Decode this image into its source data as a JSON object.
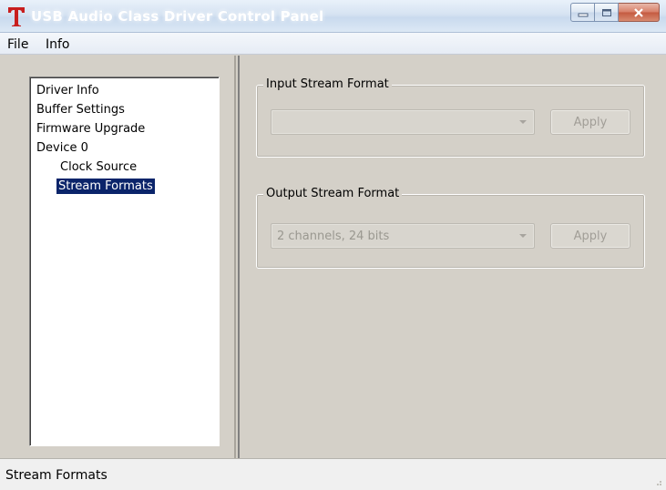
{
  "window": {
    "title": "USB Audio Class Driver Control Panel",
    "app_icon_glyph": "T",
    "app_icon_color": "#c81e1e",
    "buttons": {
      "minimize": "minimize-icon",
      "maximize": "maximize-icon",
      "close": "close-icon"
    }
  },
  "menu": {
    "items": [
      {
        "label": "File"
      },
      {
        "label": "Info"
      }
    ]
  },
  "tree": {
    "items": [
      {
        "label": "Driver Info",
        "level": 0,
        "selected": false
      },
      {
        "label": "Buffer Settings",
        "level": 0,
        "selected": false
      },
      {
        "label": "Firmware Upgrade",
        "level": 0,
        "selected": false
      },
      {
        "label": "Device 0",
        "level": 0,
        "selected": false
      },
      {
        "label": "Clock Source",
        "level": 1,
        "selected": false
      },
      {
        "label": "Stream Formats",
        "level": 1,
        "selected": true
      }
    ],
    "selection_color": "#0a246a"
  },
  "input_stream": {
    "title": "Input Stream Format",
    "selected_value": "",
    "apply_label": "Apply",
    "enabled": false
  },
  "output_stream": {
    "title": "Output Stream Format",
    "selected_value": "2 channels, 24 bits",
    "apply_label": "Apply",
    "enabled": false
  },
  "status": {
    "text": "Stream Formats"
  }
}
